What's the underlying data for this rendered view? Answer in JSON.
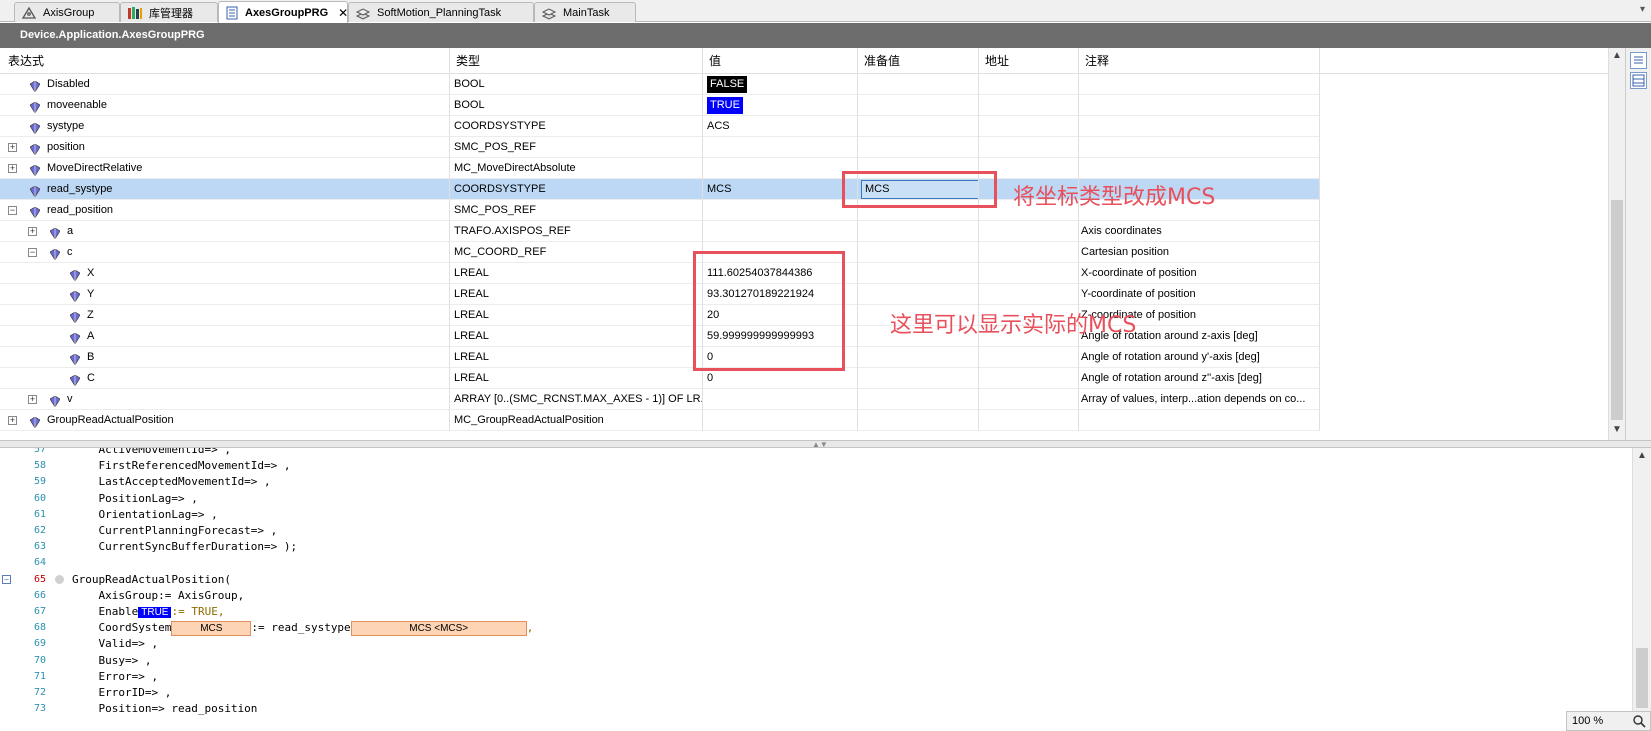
{
  "tabs": [
    {
      "label": "AxisGroup",
      "icon": "axis-group-icon",
      "active": false
    },
    {
      "label": "库管理器",
      "icon": "library-manager-icon",
      "active": false
    },
    {
      "label": "AxesGroupPRG",
      "icon": "program-icon",
      "active": true,
      "close": "✕"
    },
    {
      "label": "SoftMotion_PlanningTask",
      "icon": "task-icon",
      "active": false
    },
    {
      "label": "MainTask",
      "icon": "task-icon",
      "active": false
    }
  ],
  "path": "Device.Application.AxesGroupPRG",
  "columns": {
    "expr": "表达式",
    "type": "类型",
    "value": "值",
    "prepared": "准备值",
    "address": "地址",
    "comment": "注释"
  },
  "rows": [
    {
      "name": "Disabled",
      "type": "BOOL",
      "value": "FALSE",
      "value_style": "black",
      "prepared": "",
      "comment": "",
      "level": 1,
      "expand": ""
    },
    {
      "name": "moveenable",
      "type": "BOOL",
      "value": "TRUE",
      "value_style": "blue",
      "prepared": "",
      "comment": "",
      "level": 1,
      "expand": ""
    },
    {
      "name": "systype",
      "type": "COORDSYSTYPE",
      "value": "ACS",
      "prepared": "",
      "comment": "",
      "level": 1,
      "expand": ""
    },
    {
      "name": "position",
      "type": "SMC_POS_REF",
      "value": "",
      "prepared": "",
      "comment": "",
      "level": 1,
      "expand": "+"
    },
    {
      "name": "MoveDirectRelative",
      "type": "MC_MoveDirectAbsolute",
      "value": "",
      "prepared": "",
      "comment": "",
      "level": 1,
      "expand": "+"
    },
    {
      "name": "read_systype",
      "type": "COORDSYSTYPE",
      "value": "MCS",
      "prepared": "MCS",
      "comment": "",
      "level": 1,
      "expand": "",
      "selected": true
    },
    {
      "name": "read_position",
      "type": "SMC_POS_REF",
      "value": "",
      "prepared": "",
      "comment": "",
      "level": 1,
      "expand": "−"
    },
    {
      "name": "a",
      "type": "TRAFO.AXISPOS_REF",
      "value": "",
      "prepared": "",
      "comment": "Axis coordinates",
      "level": 2,
      "expand": "+"
    },
    {
      "name": "c",
      "type": "MC_COORD_REF",
      "value": "",
      "prepared": "",
      "comment": "Cartesian position",
      "level": 2,
      "expand": "−"
    },
    {
      "name": "X",
      "type": "LREAL",
      "value": "111.60254037844386",
      "prepared": "",
      "comment": "X-coordinate of position",
      "level": 3,
      "expand": ""
    },
    {
      "name": "Y",
      "type": "LREAL",
      "value": "93.301270189221924",
      "prepared": "",
      "comment": "Y-coordinate of position",
      "level": 3,
      "expand": ""
    },
    {
      "name": "Z",
      "type": "LREAL",
      "value": "20",
      "prepared": "",
      "comment": "Z-coordinate of position",
      "level": 3,
      "expand": ""
    },
    {
      "name": "A",
      "type": "LREAL",
      "value": "59.999999999999993",
      "prepared": "",
      "comment": "Angle of rotation around z-axis [deg]",
      "level": 3,
      "expand": ""
    },
    {
      "name": "B",
      "type": "LREAL",
      "value": "0",
      "prepared": "",
      "comment": "Angle of rotation around y'-axis [deg]",
      "level": 3,
      "expand": ""
    },
    {
      "name": "C",
      "type": "LREAL",
      "value": "0",
      "prepared": "",
      "comment": "Angle of rotation around z''-axis [deg]",
      "level": 3,
      "expand": ""
    },
    {
      "name": "v",
      "type": "ARRAY [0..(SMC_RCNST.MAX_AXES - 1)] OF LR...",
      "value": "",
      "prepared": "",
      "comment": "Array of values, interp...ation depends on co...",
      "level": 2,
      "expand": "+"
    },
    {
      "name": "GroupReadActualPosition",
      "type": "MC_GroupReadActualPosition",
      "value": "",
      "prepared": "",
      "comment": "",
      "level": 1,
      "expand": "+"
    }
  ],
  "annotations": {
    "change_type": "将坐标类型改成MCS",
    "show_mcs": "这里可以显示实际的MCS"
  },
  "code": [
    {
      "num": "57",
      "text": "    ActiveMovementId=> ,"
    },
    {
      "num": "58",
      "text": "    FirstReferencedMovementId=> ,"
    },
    {
      "num": "59",
      "text": "    LastAcceptedMovementId=> ,"
    },
    {
      "num": "60",
      "text": "    PositionLag=> ,"
    },
    {
      "num": "61",
      "text": "    OrientationLag=> ,"
    },
    {
      "num": "62",
      "text": "    CurrentPlanningForecast=> ,"
    },
    {
      "num": "63",
      "text": "    CurrentSyncBufferDuration=> );"
    },
    {
      "num": "64",
      "text": ""
    },
    {
      "num": "65",
      "text": "GroupReadActualPosition(",
      "hot": true,
      "fold": "−",
      "bp": true
    },
    {
      "num": "66",
      "text": "    AxisGroup:= AxisGroup,"
    },
    {
      "num": "67",
      "pre": "    Enable",
      "blue": "TRUE",
      "post": ":= TRUE,"
    },
    {
      "num": "68",
      "pre": "    CoordSystem",
      "orange1": "MCS",
      "mid": ":= read_systype",
      "orange2": "MCS <MCS>",
      "post": ","
    },
    {
      "num": "69",
      "text": "    Valid=> ,"
    },
    {
      "num": "70",
      "text": "    Busy=> ,"
    },
    {
      "num": "71",
      "text": "    Error=> ,"
    },
    {
      "num": "72",
      "text": "    ErrorID=> ,"
    },
    {
      "num": "73",
      "text": "    Position=> read_position"
    }
  ],
  "zoom": "100 %",
  "colors": {
    "annotation": "#e8505b",
    "selection": "#bcd8f4",
    "true_badge": "#0000ff",
    "prepared_badge": "#fdd4b4"
  }
}
